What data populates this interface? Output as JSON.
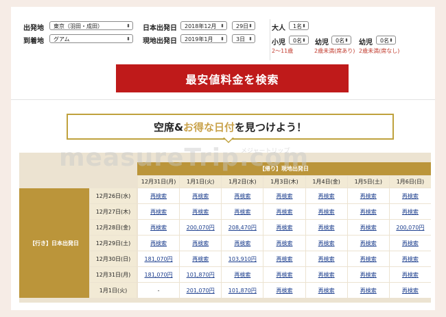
{
  "form": {
    "depart_label": "出発地",
    "depart_value": "東京（羽田・成田）",
    "arrive_label": "到着地",
    "arrive_value": "グアム",
    "jp_depart_label": "日本出発日",
    "jp_depart_month": "2018年12月",
    "jp_depart_day": "29日",
    "local_depart_label": "現地出発日",
    "local_depart_month": "2019年1月",
    "local_depart_day": "3日",
    "adult_label": "大人",
    "adult_value": "1名",
    "child_label": "小児",
    "child_value": "0名",
    "child_note": "2〜11歳",
    "infant1_label": "幼児",
    "infant1_value": "0名",
    "infant1_note": "2歳未満(席あり)",
    "infant2_label": "幼児",
    "infant2_value": "0名",
    "infant2_note": "2歳未満(席なし)",
    "search_button": "最安値料金を検索"
  },
  "banner": {
    "text_before": "空席&",
    "text_accent": "お得な日付",
    "text_after": "を見つけよう！"
  },
  "watermark": {
    "main": "measureTrip.com",
    "sub": "メジャートリップ"
  },
  "table": {
    "return_header": "【帰り】現地出発日",
    "outbound_header": "【行き】日本出発日",
    "columns": [
      "12月31日(月)",
      "1月1日(火)",
      "1月2日(水)",
      "1月3日(木)",
      "1月4日(金)",
      "1月5日(土)",
      "1月6日(日)"
    ],
    "rows": [
      {
        "date": "12月26日(水)",
        "cells": [
          "再検索",
          "再検索",
          "再検索",
          "再検索",
          "再検索",
          "再検索",
          "再検索"
        ]
      },
      {
        "date": "12月27日(木)",
        "cells": [
          "再検索",
          "再検索",
          "再検索",
          "再検索",
          "再検索",
          "再検索",
          "再検索"
        ]
      },
      {
        "date": "12月28日(金)",
        "cells": [
          "再検索",
          "200,070円",
          "208,470円",
          "再検索",
          "再検索",
          "再検索",
          "200,070円"
        ]
      },
      {
        "date": "12月29日(土)",
        "cells": [
          "再検索",
          "再検索",
          "再検索",
          "再検索",
          "再検索",
          "再検索",
          "再検索"
        ]
      },
      {
        "date": "12月30日(日)",
        "cells": [
          "181,070円",
          "再検索",
          "103,910円",
          "再検索",
          "再検索",
          "再検索",
          "再検索"
        ]
      },
      {
        "date": "12月31日(月)",
        "cells": [
          "181,070円",
          "101,870円",
          "再検索",
          "再検索",
          "再検索",
          "再検索",
          "再検索"
        ]
      },
      {
        "date": "1月1日(火)",
        "cells": [
          "-",
          "201,070円",
          "101,870円",
          "再検索",
          "再検索",
          "再検索",
          "再検索"
        ]
      }
    ]
  },
  "colors": {
    "search_button": "#bf1a1a",
    "gold": "#bb953a",
    "link": "#1a3c8c",
    "note_red": "#c0392b"
  }
}
